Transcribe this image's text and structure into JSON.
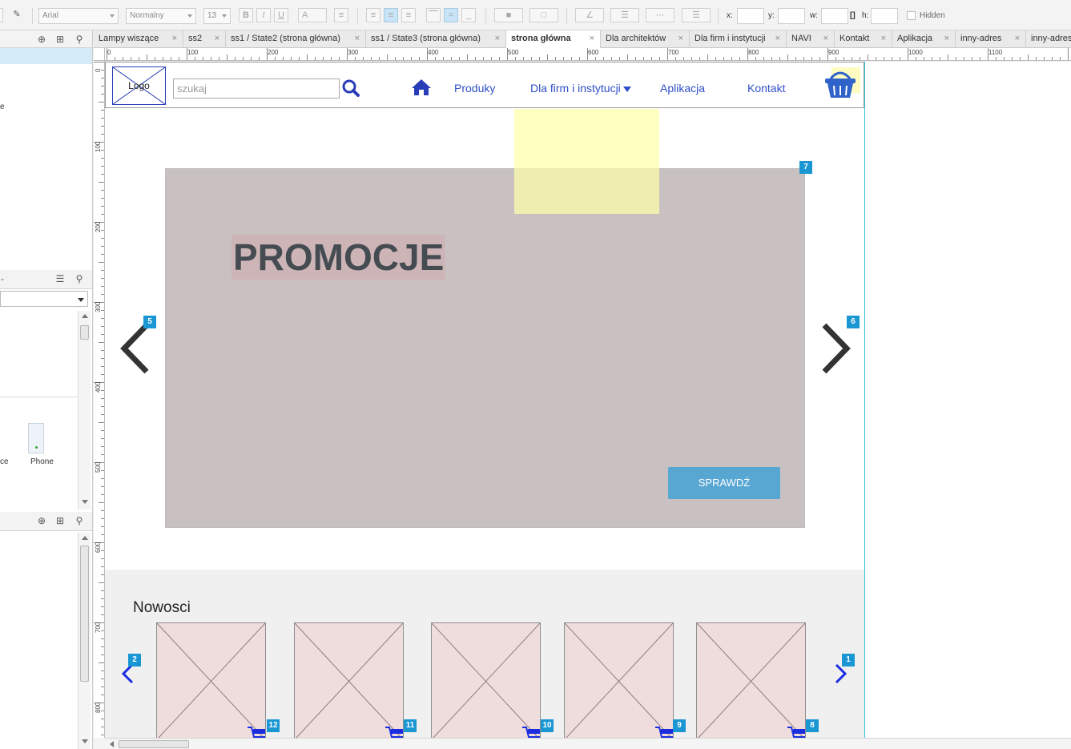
{
  "toolbar": {
    "font_family": "Arial",
    "font_style": "Normalny",
    "font_size": "13",
    "x_label": "x:",
    "y_label": "y:",
    "w_label": "w:",
    "h_label": "h:",
    "hidden_label": "Hidden"
  },
  "left_panel": {
    "snippet_1": "e",
    "widget_partial": "ce",
    "widget_phone": "Phone"
  },
  "tabs": [
    {
      "label": "Lampy wiszące",
      "active": false
    },
    {
      "label": "ss2",
      "active": false
    },
    {
      "label": "ss1 / State2 (strona główna)",
      "active": false
    },
    {
      "label": "ss1 / State3 (strona główna)",
      "active": false
    },
    {
      "label": "strona główna",
      "active": true
    },
    {
      "label": "Dla architektów",
      "active": false
    },
    {
      "label": "Dla firm i instytucji",
      "active": false
    },
    {
      "label": "NAVI",
      "active": false
    },
    {
      "label": "Kontakt",
      "active": false
    },
    {
      "label": "Aplikacja",
      "active": false
    },
    {
      "label": "inny-adres",
      "active": false
    },
    {
      "label": "inny-adres",
      "active": false
    }
  ],
  "ruler": {
    "h_labels": [
      "0",
      "100",
      "200",
      "300",
      "400",
      "500",
      "600",
      "700",
      "800",
      "900",
      "1000",
      "1100"
    ],
    "v_labels": [
      "0",
      "100",
      "200",
      "300",
      "400",
      "500",
      "600",
      "700",
      "800"
    ]
  },
  "wireframe": {
    "logo": "Logo",
    "search_placeholder": "szukaj",
    "nav": {
      "produkty": "Produky",
      "firmy": "Dla firm i instytucji",
      "aplikacja": "Aplikacja",
      "kontakt": "Kontakt"
    },
    "promo_title": "PROMOCJE",
    "promo_button": "SPRAWDŹ",
    "news_title": "Nowosci",
    "badges": {
      "promo": "7",
      "prev": "5",
      "next": "6",
      "news_prev": "2",
      "news_next": "1",
      "cart_1": "12",
      "cart_2": "11",
      "cart_3": "10",
      "cart_4": "9",
      "cart_5": "8"
    }
  },
  "colors": {
    "accent_blue": "#2f4fc9",
    "badge_blue": "#1a96d3",
    "promo_bg": "#c9c1c1",
    "button_blue": "#58a6d2",
    "sticky_yellow": "#ffffa8"
  }
}
